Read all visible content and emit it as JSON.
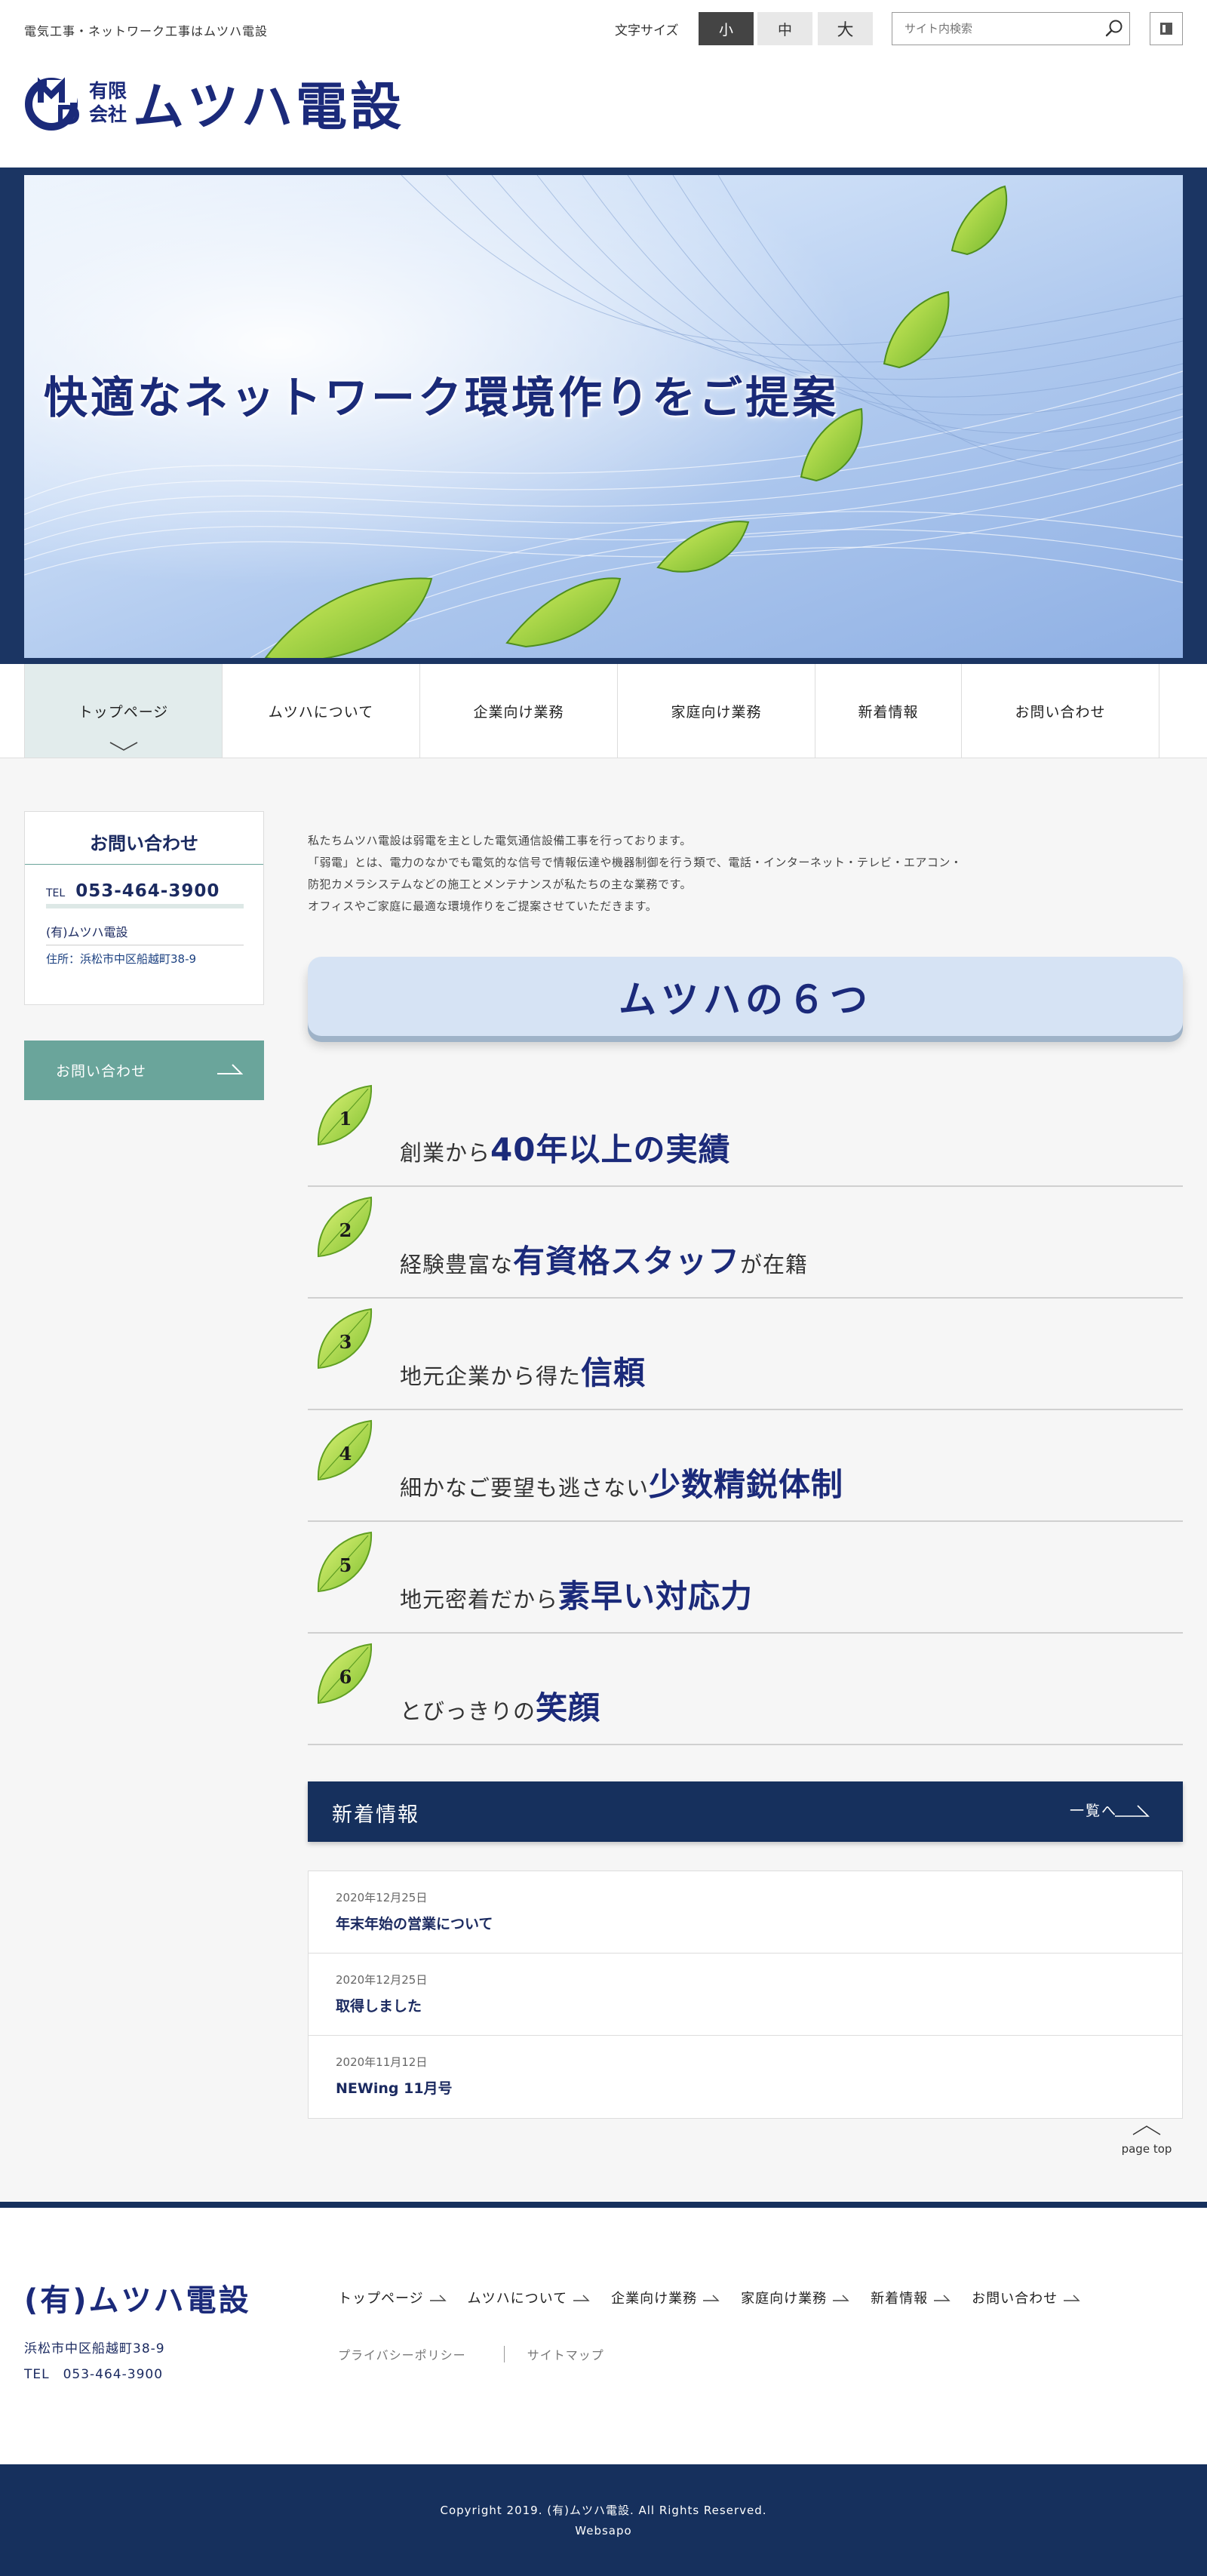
{
  "header": {
    "tagline": "電気工事・ネットワーク工事はムツハ電設",
    "logo_small_top": "有限",
    "logo_small_bottom": "会社",
    "logo_name": "ムツハ電設",
    "font_size_label": "文字サイズ",
    "font_sizes": [
      "小",
      "中",
      "大"
    ],
    "font_size_selected": "小",
    "search_placeholder": "サイト内検索"
  },
  "hero": {
    "caption": "快適なネットワーク環境作りをご提案"
  },
  "nav": {
    "items": [
      "トップページ",
      "ムツハについて",
      "企業向け業務",
      "家庭向け業務",
      "新着情報",
      "お問い合わせ"
    ],
    "active": "トップページ"
  },
  "sidebar": {
    "contact_title": "お問い合わせ",
    "tel_label": "TEL",
    "tel": "053-464-3900",
    "company": "(有)ムツハ電設",
    "address": "住所：浜松市中区船越町38-9",
    "contact_button": "お問い合わせ"
  },
  "main": {
    "intro": [
      "私たちムツハ電設は弱電を主とした電気通信設備工事を行っております。",
      "「弱電」とは、電力のなかでも電気的な信号で情報伝達や機器制御を行う類で、電話・インターネット・テレビ・エアコン・",
      "防犯カメラシステムなどの施工とメンテナンスが私たちの主な業務です。",
      "オフィスやご家庭に最適な環境作りをご提案させていただきます。"
    ],
    "six_title": "ムツハの６つ",
    "features": [
      {
        "num": "1",
        "pre": "創業から",
        "em": "40年以上の実績",
        "post": ""
      },
      {
        "num": "2",
        "pre": "経験豊富な",
        "em": "有資格スタッフ",
        "post": "が在籍"
      },
      {
        "num": "3",
        "pre": "地元企業から得た",
        "em": "信頼",
        "post": ""
      },
      {
        "num": "4",
        "pre": "細かなご要望も逃さない",
        "em": "少数精鋭体制",
        "post": ""
      },
      {
        "num": "5",
        "pre": "地元密着だから",
        "em": "素早い対応力",
        "post": ""
      },
      {
        "num": "6",
        "pre": "とびっきりの",
        "em": "笑顔",
        "post": ""
      }
    ]
  },
  "news": {
    "title": "新着情報",
    "all_label": "一覧へ",
    "items": [
      {
        "date": "2020年12月25日",
        "text": "年末年始の営業について"
      },
      {
        "date": "2020年12月25日",
        "text": "取得しました"
      },
      {
        "date": "2020年11月12日",
        "text": "NEWing 11月号"
      }
    ],
    "page_top": "page top"
  },
  "footer": {
    "company": "(有)ムツハ電設",
    "address": "浜松市中区船越町38-9",
    "tel": "TEL　053-464-3900",
    "nav": [
      "トップページ",
      "ムツハについて",
      "企業向け業務",
      "家庭向け業務",
      "新着情報",
      "お問い合わせ"
    ],
    "privacy": "プライバシーポリシー",
    "sitemap": "サイトマップ",
    "copyright": "Copyright 2019. (有)ムツハ電設. All Rights Reserved.",
    "websapo": "Websapo"
  },
  "colors": {
    "brand_navy": "#1b2a7a",
    "dark_navy": "#16305d",
    "teal": "#6aa59b",
    "leaf_green": "#8cc63f"
  }
}
